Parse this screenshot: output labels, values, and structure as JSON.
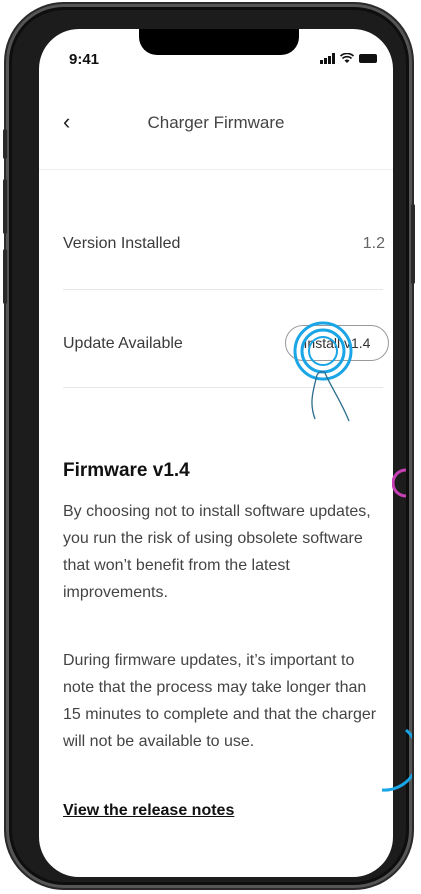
{
  "status_bar": {
    "time": "9:41"
  },
  "header": {
    "title": "Charger Firmware",
    "back_icon": "chevron-left-icon"
  },
  "rows": {
    "version_label": "Version Installed",
    "version_value": "1.2",
    "update_label": "Update Available",
    "install_button": "Install v1.4"
  },
  "firmware": {
    "title": "Firmware v1.4",
    "paragraph_1": "By choosing not to install software updates, you run the risk of using obsolete software that won’t benefit from the latest improvements.",
    "paragraph_2": "During firmware updates, it’s important to note that the process may take longer than 15 minutes to complete and that the charger will not be available to use.",
    "release_notes_link": "View the release notes"
  },
  "colors": {
    "accent_tap": "#1aa6e6",
    "frame": "#1c1c1c"
  }
}
